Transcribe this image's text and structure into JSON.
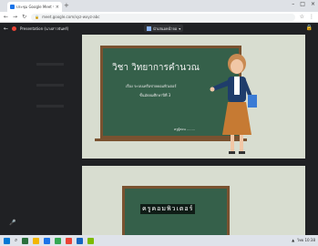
{
  "browser": {
    "tab_title": "ประชุม Google Meet ร่วม...",
    "tab_close": "×",
    "new_tab": "+",
    "window_controls": [
      "–",
      "□",
      "×"
    ],
    "nav_icons": [
      "←",
      "→",
      "↻"
    ],
    "url": "meet.google.com/xyz-wxyz-abc",
    "right_icons": [
      "☆",
      "⋮"
    ]
  },
  "meet": {
    "back": "←",
    "presenter": "Presentation (นางสาวจันทร์)",
    "chip_label": "นำเสนอหน้าจอ",
    "chip_caret": "▾",
    "right_icon": "🔒"
  },
  "slide1": {
    "title": "วิชา วิทยาการคำนวณ",
    "line1": "เรื่อง  ระบบเครือข่ายคอมพิวเตอร์",
    "line2": "ชั้นมัธยมศึกษาปีที่ 3",
    "author": "ครูผู้สอน ........"
  },
  "slide2": {
    "caption": "ครูคอมพิวเตอร์"
  },
  "taskbar": {
    "tray_text": "ไทย  10:38"
  }
}
